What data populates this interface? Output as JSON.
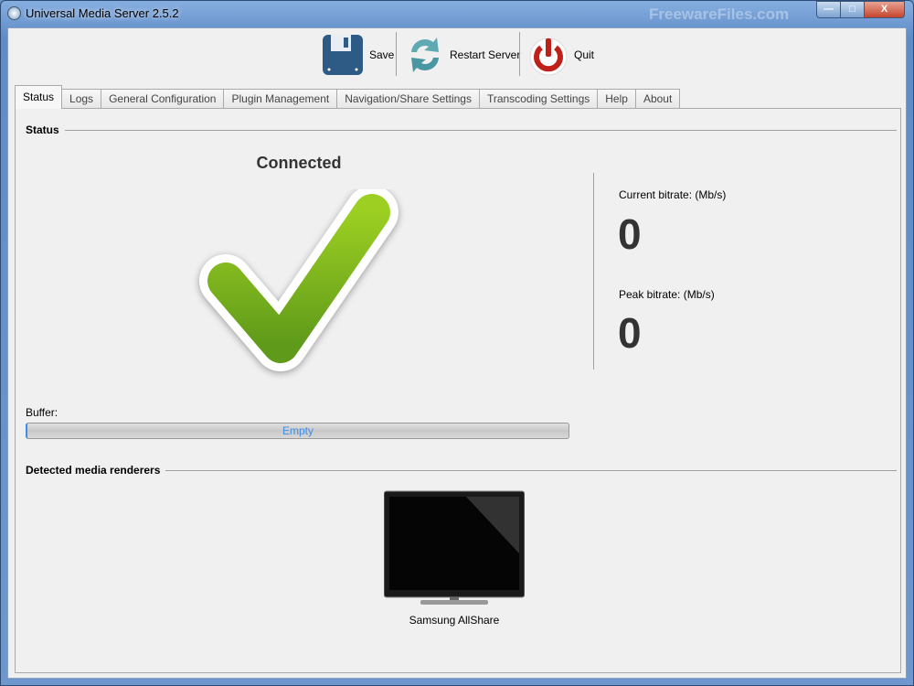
{
  "window": {
    "title": "Universal Media Server 2.5.2",
    "watermark": "FreewareFiles.com",
    "minimize": "—",
    "maximize": "□",
    "close": "X"
  },
  "toolbar": {
    "save": "Save",
    "restart": "Restart Server",
    "quit": "Quit"
  },
  "tabs": [
    "Status",
    "Logs",
    "General Configuration",
    "Plugin Management",
    "Navigation/Share Settings",
    "Transcoding Settings",
    "Help",
    "About"
  ],
  "status": {
    "section": "Status",
    "state": "Connected",
    "current_bitrate_label": "Current bitrate: (Mb/s)",
    "current_bitrate": "0",
    "peak_bitrate_label": "Peak bitrate: (Mb/s)",
    "peak_bitrate": "0",
    "buffer_label": "Buffer:",
    "buffer_text": "Empty",
    "buffer_fill": 0
  },
  "renderers": {
    "section": "Detected media renderers",
    "items": [
      {
        "name": "Samsung AllShare"
      }
    ]
  },
  "colors": {
    "accent": "#3c8ee8",
    "check": "#7cbb1e"
  }
}
